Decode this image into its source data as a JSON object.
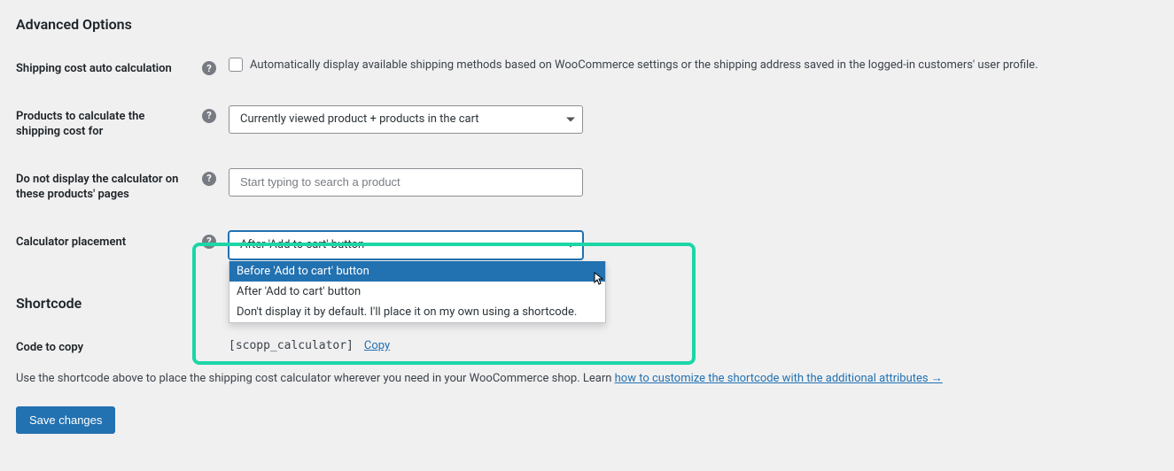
{
  "headings": {
    "advanced_options": "Advanced Options",
    "shortcode": "Shortcode"
  },
  "fields": {
    "shipping_auto": {
      "label": "Shipping cost auto calculation",
      "description": "Automatically display available shipping methods based on WooCommerce settings or the shipping address saved in the logged-in customers' user profile."
    },
    "products_calc": {
      "label": "Products to calculate the shipping cost for",
      "selected": "Currently viewed product + products in the cart"
    },
    "exclude_products": {
      "label": "Do not display the calculator on these products' pages",
      "placeholder": "Start typing to search a product"
    },
    "placement": {
      "label": "Calculator placement",
      "selected": "After 'Add to cart' button",
      "options": [
        "Before 'Add to cart' button",
        "After 'Add to cart' button",
        "Don't display it by default. I'll place it on my own using a shortcode."
      ]
    },
    "code_to_copy": {
      "label": "Code to copy",
      "shortcode": "[scopp_calculator]",
      "copy_label": "Copy"
    }
  },
  "help_text": {
    "prefix": "Use the shortcode above to place the shipping cost calculator wherever you need in your WooCommerce shop. Learn ",
    "link": "how to customize the shortcode with the additional attributes →"
  },
  "buttons": {
    "save": "Save changes"
  }
}
